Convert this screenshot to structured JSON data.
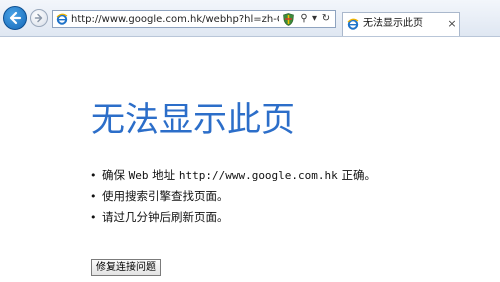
{
  "browser": {
    "address_url": "http://www.google.com.hk/webhp?hl=zh-CN&",
    "address_controls": {
      "search": "⚲",
      "dropdown": "▾",
      "refresh": "↻"
    },
    "tab": {
      "title": "无法显示此页",
      "close": "×"
    },
    "icons": {
      "back": "back-arrow-icon",
      "forward": "forward-arrow-icon",
      "site": "ie-logo-icon",
      "shield": "compatibility-shield-icon"
    },
    "colors": {
      "back_button": "#1b6fc2",
      "title_blue": "#2c6ec9"
    }
  },
  "page": {
    "title": "无法显示此页",
    "tips": [
      {
        "before": "确保 ",
        "mono1": "Web",
        "middle": " 地址 ",
        "mono2": "http://www.google.com.hk",
        "after": " 正确。"
      },
      {
        "text": "使用搜索引擎查找页面。"
      },
      {
        "text": "请过几分钟后刷新页面。"
      }
    ],
    "bullet": "•",
    "fix_button": "修复连接问题"
  }
}
